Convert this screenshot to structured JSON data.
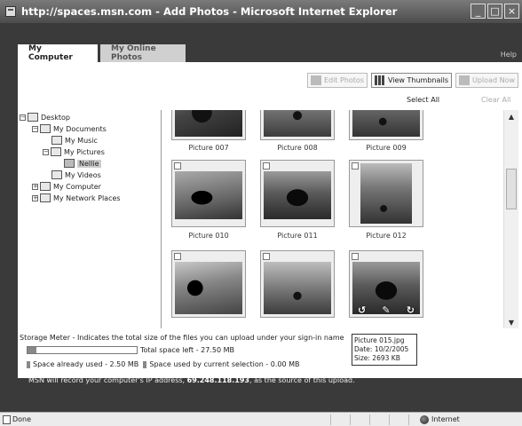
{
  "window": {
    "title": "http://spaces.msn.com - Add Photos - Microsoft Internet Explorer",
    "min_glyph": "_",
    "max_glyph": "□",
    "close_glyph": "×"
  },
  "tabs": {
    "my_computer": "My Computer",
    "my_online_photos": "My Online Photos",
    "help": "Help"
  },
  "toolbar": {
    "edit_photos": "Edit Photos",
    "view_thumbnails": "View Thumbnails",
    "upload_now": "Upload Now",
    "select_all": "Select All",
    "clear_all": "Clear All"
  },
  "tree": {
    "expand_glyph": "−",
    "collapse_glyph": "+",
    "items": [
      {
        "label": "Desktop"
      },
      {
        "label": "My Documents"
      },
      {
        "label": "My Music"
      },
      {
        "label": "My Pictures"
      },
      {
        "label": "Nellie"
      },
      {
        "label": "My Videos"
      },
      {
        "label": "My Computer"
      },
      {
        "label": "My Network Places"
      }
    ]
  },
  "photos": [
    {
      "caption": "Picture 007"
    },
    {
      "caption": "Picture 008"
    },
    {
      "caption": "Picture 009"
    },
    {
      "caption": "Picture 010"
    },
    {
      "caption": "Picture 011"
    },
    {
      "caption": "Picture 012"
    },
    {
      "caption": ""
    },
    {
      "caption": ""
    },
    {
      "caption": ""
    }
  ],
  "image_tools": {
    "rotate_left": "↺",
    "edit": "✎",
    "rotate_right": "↻"
  },
  "scroll": {
    "up": "▲",
    "down": "▼"
  },
  "storage": {
    "description": "Storage Meter - Indicates the total size of the files you can upload under your sign-in name",
    "total_left": "Total space left - 27.50 MB",
    "already_used": "Space already used - 2.50 MB",
    "current_selection": "Space used by current selection - 0.00 MB",
    "used_fraction": 0.0833
  },
  "tooltip": {
    "filename": "Picture 015.jpg",
    "date": "Date: 10/2/2005",
    "size": "Size: 2693 KB"
  },
  "ip_note": {
    "prefix": "MSN will record your computer's IP address, ",
    "ip": "69.248.118.193",
    "suffix": ", as the source of this upload."
  },
  "statusbar": {
    "status": "Done",
    "zone": "Internet"
  }
}
